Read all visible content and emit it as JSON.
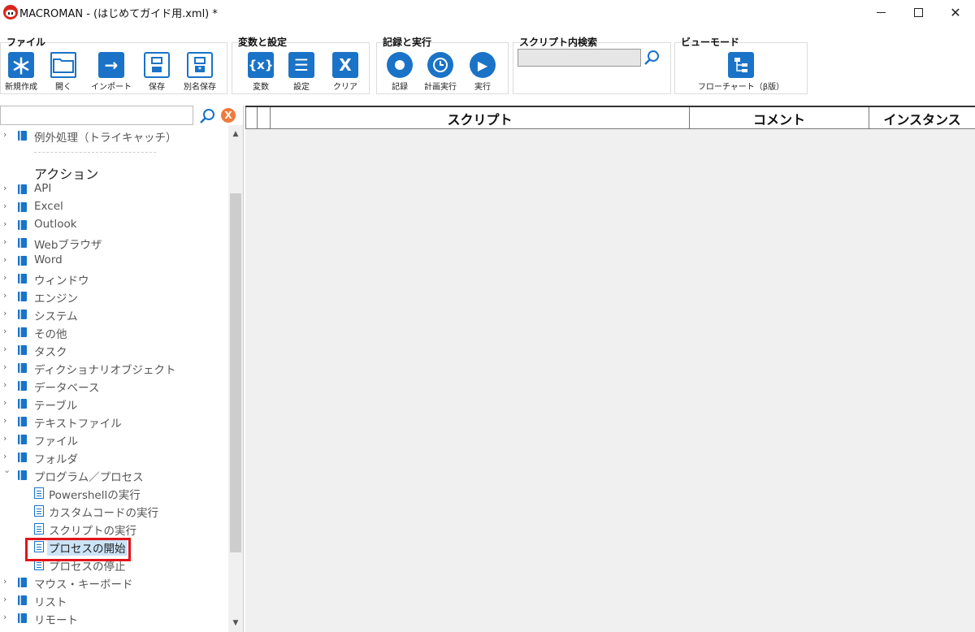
{
  "window": {
    "title": "MACROMAN - (はじめてガイド用.xml) *",
    "minimize": "minimize",
    "maximize": "maximize",
    "close": "✕"
  },
  "ribbon": {
    "file": {
      "title": "ファイル",
      "buttons": [
        {
          "label": "新規作成",
          "icon": "＊"
        },
        {
          "label": "開く",
          "icon": ""
        },
        {
          "label": "インポート",
          "icon": "→"
        },
        {
          "label": "保存",
          "icon": ""
        },
        {
          "label": "別名保存",
          "icon": ""
        }
      ]
    },
    "vars": {
      "title": "変数と設定",
      "buttons": [
        {
          "label": "変数",
          "icon": "{x}"
        },
        {
          "label": "設定",
          "icon": "☰"
        },
        {
          "label": "クリア",
          "icon": "X"
        }
      ]
    },
    "record": {
      "title": "記録と実行",
      "buttons": [
        {
          "label": "記録",
          "icon": ""
        },
        {
          "label": "計画実行",
          "icon": ""
        },
        {
          "label": "実行",
          "icon": "▶"
        }
      ]
    },
    "search": {
      "title": "スクリプト内検索",
      "value": ""
    },
    "view": {
      "title": "ビューモード",
      "button_label": "フローチャート（β版）"
    }
  },
  "filter": {
    "value": "",
    "clear_icon": "X"
  },
  "tree": {
    "top_item": "例外処理（トライキャッチ）",
    "section": "アクション",
    "categories": [
      "API",
      "Excel",
      "Outlook",
      "Webブラウザ",
      "Word",
      "ウィンドウ",
      "エンジン",
      "システム",
      "その他",
      "タスク",
      "ディクショナリオブジェクト",
      "データベース",
      "テーブル",
      "テキストファイル",
      "ファイル",
      "フォルダ"
    ],
    "expanded": "プログラム／プロセス",
    "children": [
      "Powershellの実行",
      "カスタムコードの実行",
      "スクリプトの実行",
      "プロセスの開始",
      "プロセスの停止"
    ],
    "after": [
      "マウス・キーボード",
      "リスト",
      "リモート"
    ]
  },
  "grid": {
    "columns": [
      "スクリプト",
      "コメント",
      "インスタンス"
    ]
  },
  "colors": {
    "accent": "#1a73c7",
    "highlight": "#e3141b",
    "clear": "#f07a3c"
  }
}
